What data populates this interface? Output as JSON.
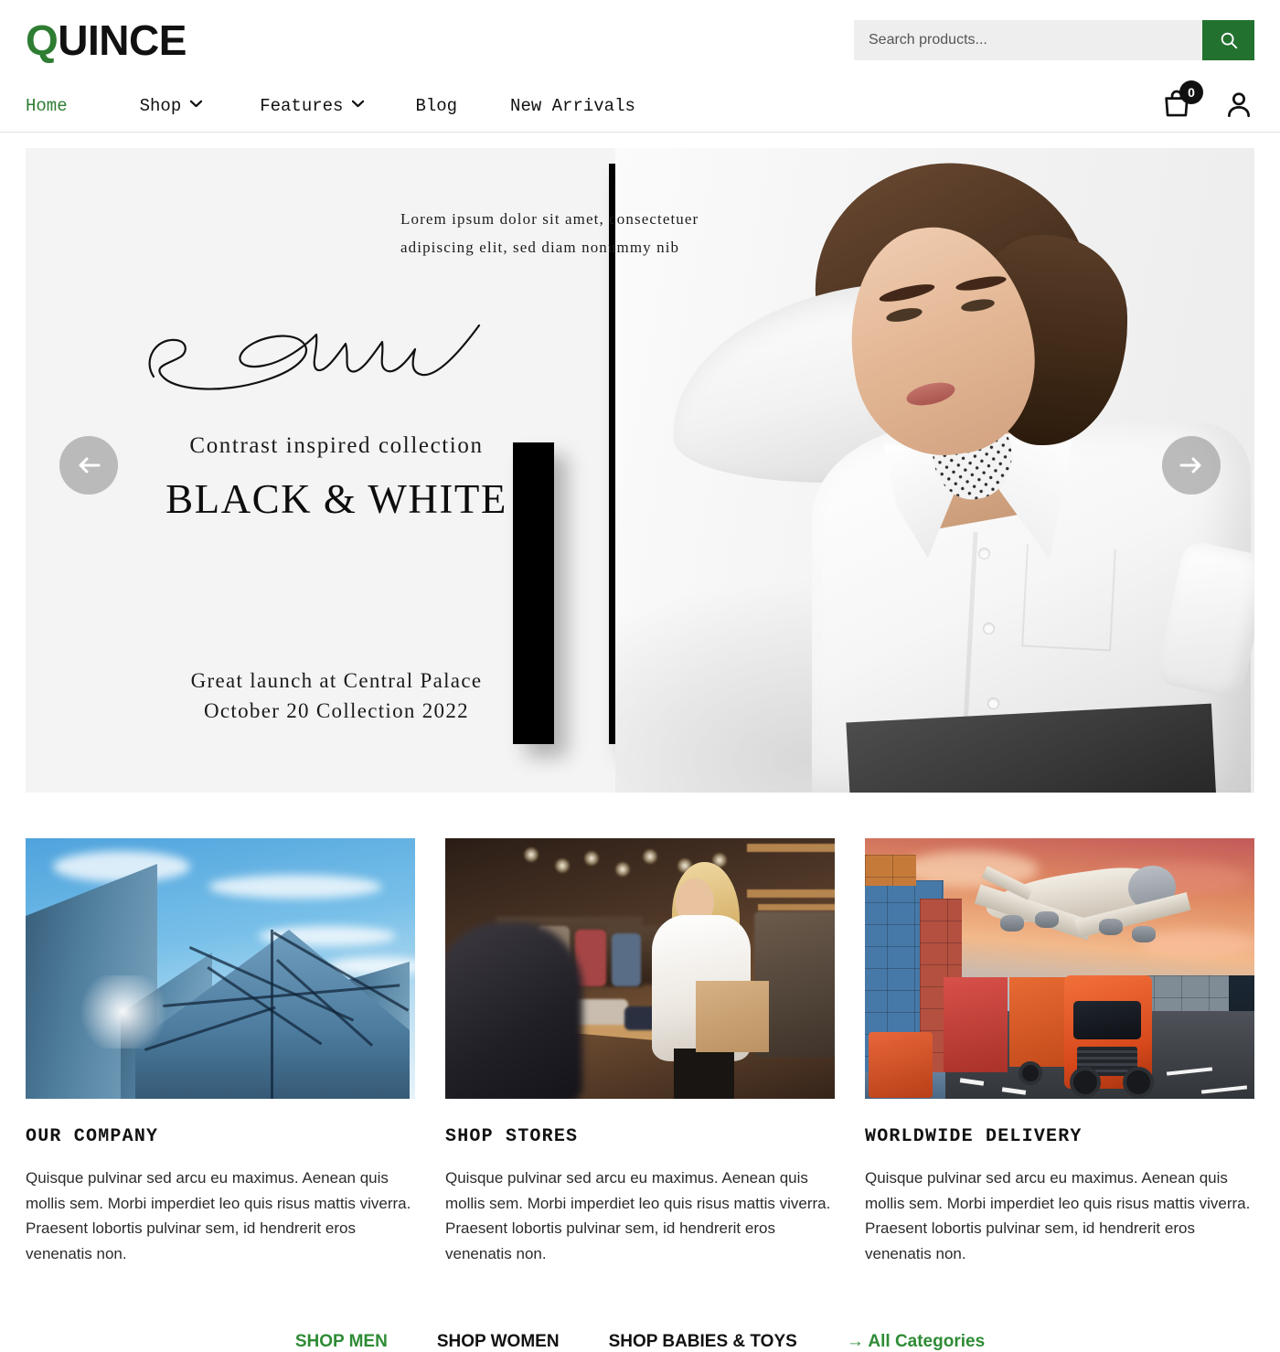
{
  "brand": {
    "logo_first": "Q",
    "logo_rest": "UINCE",
    "accent_green": "#2e7d32",
    "button_green": "#23712f"
  },
  "search": {
    "placeholder": "Search products...",
    "value": "",
    "icon": "search-icon"
  },
  "nav": {
    "items": [
      {
        "label": "Home",
        "active": true,
        "has_dropdown": false
      },
      {
        "label": "Shop",
        "active": false,
        "has_dropdown": true
      },
      {
        "label": "Features",
        "active": false,
        "has_dropdown": true
      },
      {
        "label": "Blog",
        "active": false,
        "has_dropdown": false
      },
      {
        "label": "New Arrivals",
        "active": false,
        "has_dropdown": false
      }
    ],
    "chevron": "⌄",
    "cart_count": "0",
    "cart_icon": "shopping-bag-icon",
    "account_icon": "user-account-icon"
  },
  "hero": {
    "lorem": "Lorem ipsum dolor sit amet, consectetuer adipiscing elit, sed diam nonummy nib",
    "kicker": "Contrast inspired collection",
    "title": "BLACK & WHITE",
    "footnote_line1": "Great launch at Central Palace",
    "footnote_line2": "October 20 Collection 2022",
    "prev_arrow": "←",
    "next_arrow": "→",
    "background": "#f4f4f4"
  },
  "cards": [
    {
      "title": "OUR COMPANY",
      "text": "Quisque pulvinar sed arcu eu maximus. Aenean quis mollis sem. Morbi imperdiet leo quis risus mattis viverra. Praesent lobortis pulvinar sem, id hendrerit eros venenatis non.",
      "image": "glass-skyscrapers-blue-sky-photo"
    },
    {
      "title": "SHOP STORES",
      "text": "Quisque pulvinar sed arcu eu maximus. Aenean quis mollis sem. Morbi imperdiet leo quis risus mattis viverra. Praesent lobortis pulvinar sem, id hendrerit eros venenatis non.",
      "image": "woman-shopping-clothing-store-photo"
    },
    {
      "title": "WORLDWIDE DELIVERY",
      "text": "Quisque pulvinar sed arcu eu maximus. Aenean quis mollis sem. Morbi imperdiet leo quis risus mattis viverra. Praesent lobortis pulvinar sem, id hendrerit eros venenatis non.",
      "image": "cargo-plane-truck-containers-logistics-photo"
    }
  ],
  "categories": [
    {
      "label": "SHOP MEN",
      "green": true
    },
    {
      "label": "SHOP WOMEN",
      "green": false
    },
    {
      "label": "SHOP BABIES & TOYS",
      "green": false
    },
    {
      "label": "→ All Categories",
      "green": true
    }
  ]
}
